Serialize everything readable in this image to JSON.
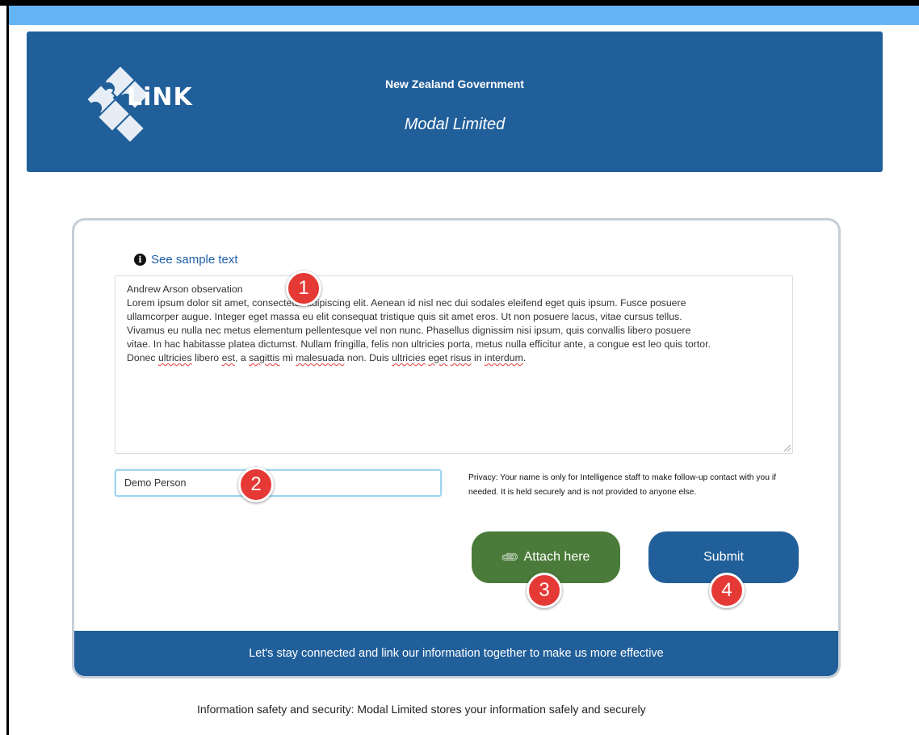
{
  "header": {
    "logo_text": "LiNK",
    "government": "New Zealand Government",
    "company": "Modal Limited"
  },
  "form": {
    "sample_link": "See sample text",
    "observation_lines": [
      "Andrew Arson observation",
      "Lorem ipsum dolor sit amet, consectetur adipiscing elit. Aenean id nisl nec dui sodales eleifend eget quis ipsum. Fusce posuere",
      "ullamcorper augue. Integer eget massa eu elit consequat tristique quis sit amet eros. Ut non posuere lacus, vitae cursus tellus.",
      "Vivamus eu nulla nec metus elementum pellentesque vel non nunc. Phasellus dignissim nisi ipsum, quis convallis libero posuere",
      "vitae. In hac habitasse platea dictumst. Nullam fringilla, felis non ultricies porta, metus nulla efficitur ante, a congue est leo quis tortor."
    ],
    "last_line": {
      "p1": "Donec ",
      "w1": "ultricies",
      "p2": " libero ",
      "w2": "est",
      "p3": ", a ",
      "w3": "sagittis",
      "p4": " mi ",
      "w4": "malesuada",
      "p5": " non. Duis ",
      "w5": "ultricies",
      "p6": " ",
      "w6": "eget",
      "p7": " ",
      "w7": "risus",
      "p8": " in ",
      "w8": "interdum",
      "p9": "."
    },
    "name_value": "Demo Person",
    "privacy_text": "Privacy: Your name is only for Intelligence staff to make follow-up contact with you if needed. It is held securely and is not provided to anyone else.",
    "attach_label": "Attach here",
    "submit_label": "Submit",
    "footer_band": "Let's stay connected and link our information together to make us more effective"
  },
  "page_footer": "Information safety and security: Modal Limited stores your information safely and securely",
  "markers": [
    "1",
    "2",
    "3",
    "4"
  ],
  "colors": {
    "top_strip": "#64b4f5",
    "brand_blue": "#215f9a",
    "attach_green": "#4b7b3a",
    "marker_red": "#e53935"
  },
  "icons": {
    "info": "info-icon",
    "attach": "paperclip-icon",
    "logo": "puzzle-logo"
  }
}
